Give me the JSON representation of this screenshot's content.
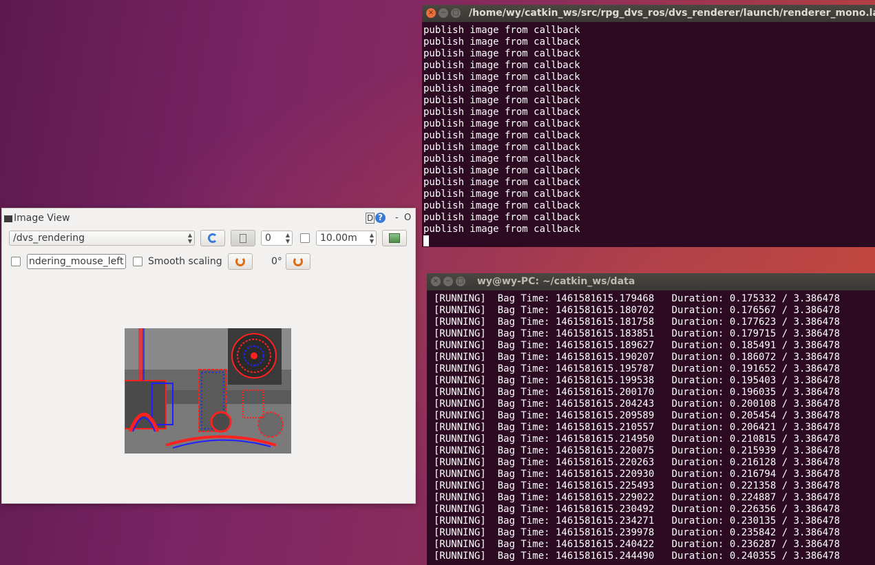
{
  "terminal1": {
    "title": "/home/wy/catkin_ws/src/rpg_dvs_ros/dvs_renderer/launch/renderer_mono.launch",
    "window_buttons": [
      "×",
      "−",
      "□"
    ],
    "lines": [
      "publish image from callback",
      "publish image from callback",
      "publish image from callback",
      "publish image from callback",
      "publish image from callback",
      "publish image from callback",
      "publish image from callback",
      "publish image from callback",
      "publish image from callback",
      "publish image from callback",
      "publish image from callback",
      "publish image from callback",
      "publish image from callback",
      "publish image from callback",
      "publish image from callback",
      "publish image from callback",
      "publish image from callback",
      "publish image from callback"
    ]
  },
  "terminal2": {
    "title": "wy@wy-PC: ~/catkin_ws/data",
    "window_buttons": [
      "×",
      "−",
      "□"
    ],
    "lines": [
      "[RUNNING]  Bag Time: 1461581615.179468   Duration: 0.175332 / 3.386478",
      "[RUNNING]  Bag Time: 1461581615.180702   Duration: 0.176567 / 3.386478",
      "[RUNNING]  Bag Time: 1461581615.181758   Duration: 0.177623 / 3.386478",
      "[RUNNING]  Bag Time: 1461581615.183851   Duration: 0.179715 / 3.386478",
      "[RUNNING]  Bag Time: 1461581615.189627   Duration: 0.185491 / 3.386478",
      "[RUNNING]  Bag Time: 1461581615.190207   Duration: 0.186072 / 3.386478",
      "[RUNNING]  Bag Time: 1461581615.195787   Duration: 0.191652 / 3.386478",
      "[RUNNING]  Bag Time: 1461581615.199538   Duration: 0.195403 / 3.386478",
      "[RUNNING]  Bag Time: 1461581615.200170   Duration: 0.196035 / 3.386478",
      "[RUNNING]  Bag Time: 1461581615.204243   Duration: 0.200108 / 3.386478",
      "[RUNNING]  Bag Time: 1461581615.209589   Duration: 0.205454 / 3.386478",
      "[RUNNING]  Bag Time: 1461581615.210557   Duration: 0.206421 / 3.386478",
      "[RUNNING]  Bag Time: 1461581615.214950   Duration: 0.210815 / 3.386478",
      "[RUNNING]  Bag Time: 1461581615.220075   Duration: 0.215939 / 3.386478",
      "[RUNNING]  Bag Time: 1461581615.220263   Duration: 0.216128 / 3.386478",
      "[RUNNING]  Bag Time: 1461581615.220930   Duration: 0.216794 / 3.386478",
      "[RUNNING]  Bag Time: 1461581615.225493   Duration: 0.221358 / 3.386478",
      "[RUNNING]  Bag Time: 1461581615.229022   Duration: 0.224887 / 3.386478",
      "[RUNNING]  Bag Time: 1461581615.230492   Duration: 0.226356 / 3.386478",
      "[RUNNING]  Bag Time: 1461581615.234271   Duration: 0.230135 / 3.386478",
      "[RUNNING]  Bag Time: 1461581615.239978   Duration: 0.235842 / 3.386478",
      "[RUNNING]  Bag Time: 1461581615.240422   Duration: 0.236287 / 3.386478",
      "[RUNNING]  Bag Time: 1461581615.244490   Duration: 0.240355 / 3.386478"
    ]
  },
  "image_view": {
    "title": "Image View",
    "title_controls": {
      "d": "D",
      "help": "?",
      "minimize": "-",
      "close": "O"
    },
    "topic_value": "/dvs_rendering",
    "zoom_value": "0",
    "duration_value": "10.00m",
    "mouse_topic_value": "ndering_mouse_left",
    "smooth_scaling_label": "Smooth scaling",
    "rotation_value": "0°"
  },
  "colors": {
    "terminal_bg": "#2c0a22",
    "positive_events": "#ff2020",
    "negative_events": "#2020ff"
  }
}
